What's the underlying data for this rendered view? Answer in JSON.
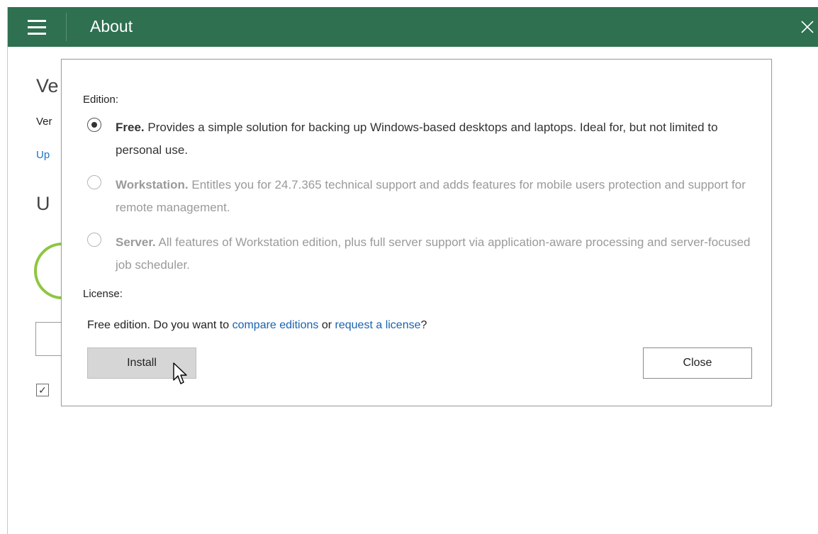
{
  "window": {
    "title": "About"
  },
  "background": {
    "heading1_fragment": "Ve",
    "version_fragment": "Ver",
    "link_fragment": "Up",
    "heading2_fragment": "U",
    "checkbox_mark": "✓"
  },
  "dialog": {
    "edition_label": "Edition:",
    "options": [
      {
        "name": "Free.",
        "desc": " Provides a simple solution for backing up Windows-based desktops and laptops. Ideal for, but not limited to personal use.",
        "selected": true,
        "enabled": true
      },
      {
        "name": "Workstation.",
        "desc": " Entitles you for 24.7.365 technical support and adds features for mobile users protection and support for remote management.",
        "selected": false,
        "enabled": false
      },
      {
        "name": "Server.",
        "desc": " All features of Workstation edition, plus full server support via application-aware processing and server-focused job scheduler.",
        "selected": false,
        "enabled": false
      }
    ],
    "license_label": "License:",
    "license_text_prefix": "Free edition. Do you want to ",
    "compare_link": "compare editions",
    "license_text_mid": " or ",
    "request_link": "request a license",
    "license_text_suffix": "?",
    "install_button": "Install",
    "close_button": "Close"
  },
  "colors": {
    "titlebar": "#2e7050",
    "link": "#1a63b0",
    "accent_green": "#8dc63f"
  }
}
